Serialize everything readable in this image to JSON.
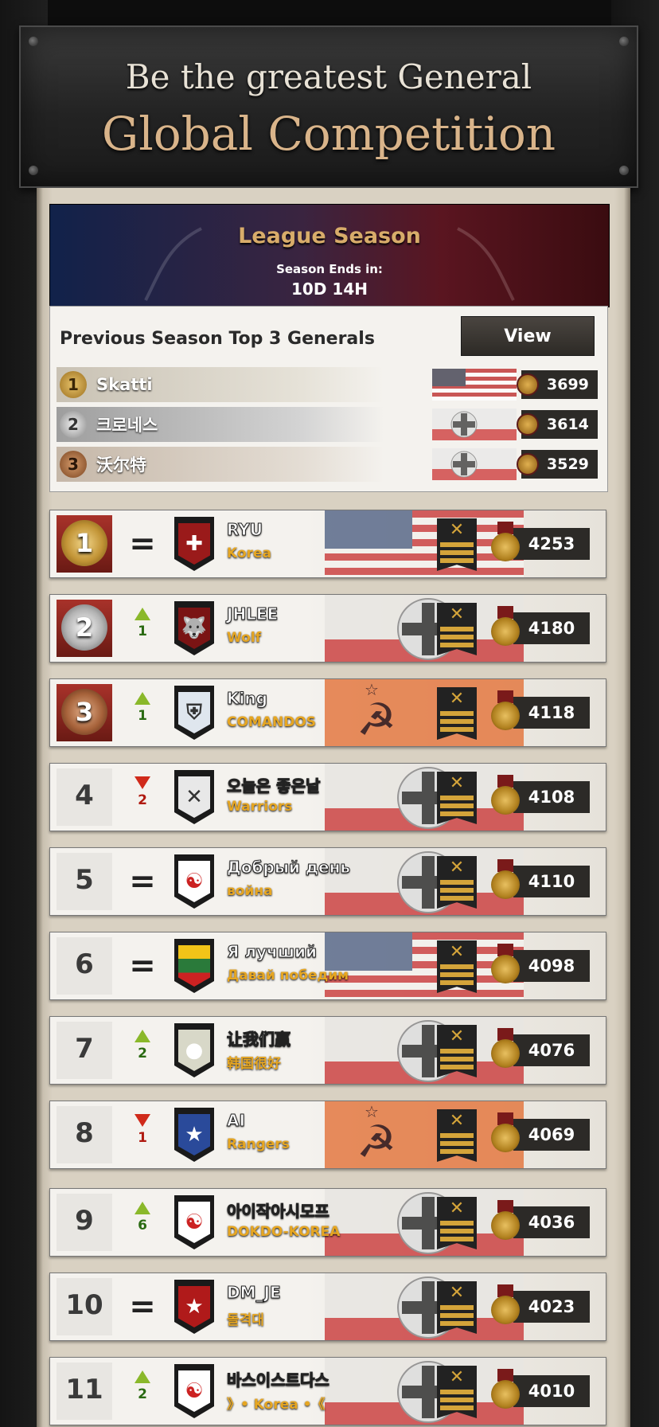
{
  "banner": {
    "subtitle": "Be the greatest General",
    "title": "Global Competition"
  },
  "season": {
    "title": "League Season",
    "ends_label": "Season Ends in:",
    "time_left": "10D 14H"
  },
  "previous": {
    "label": "Previous Season Top 3 Generals",
    "view_label": "View",
    "top": [
      {
        "rank": "1",
        "name": "Skatti",
        "flag": "usa",
        "score": "3699"
      },
      {
        "rank": "2",
        "name": "크로네스",
        "flag": "germany",
        "score": "3614"
      },
      {
        "rank": "3",
        "name": "沃尔特",
        "flag": "germany",
        "score": "3529"
      }
    ]
  },
  "rankings": [
    {
      "rank": "1",
      "change": "=",
      "name": "RYU",
      "clan": "Korea",
      "flag": "usa",
      "score": "4253",
      "emblem": "cross-emblem",
      "emblem_color": "#9a1a1a"
    },
    {
      "rank": "2",
      "change": "up",
      "change_value": "1",
      "name": "JHLEE",
      "clan": "Wolf",
      "flag": "germany",
      "score": "4180",
      "emblem": "wolf-emblem",
      "emblem_color": "#7a1414"
    },
    {
      "rank": "3",
      "change": "up",
      "change_value": "1",
      "name": "King",
      "clan": "COMANDOS",
      "flag": "soviet",
      "score": "4118",
      "emblem": "shield-emblem",
      "emblem_color": "#dfe6ee"
    },
    {
      "rank": "4",
      "change": "down",
      "change_value": "2",
      "name": "오늘은 좋은날",
      "clan": "Warriors",
      "flag": "germany",
      "score": "4108",
      "emblem": "crossed-rifles-emblem",
      "emblem_color": "#e8e8e8"
    },
    {
      "rank": "5",
      "change": "=",
      "name": "Добрый день",
      "clan": "война",
      "flag": "germany",
      "score": "4110",
      "emblem": "korea-emblem",
      "emblem_color": "#ffffff"
    },
    {
      "rank": "6",
      "change": "=",
      "name": "Я лучший",
      "clan": "Давай победим",
      "flag": "usa",
      "score": "4098",
      "emblem": "lithuania-emblem",
      "emblem_color": "#f2c418"
    },
    {
      "rank": "7",
      "change": "up",
      "change_value": "2",
      "name": "让我们赢",
      "clan": "韩国很好",
      "flag": "germany",
      "score": "4076",
      "emblem": "grenade-emblem",
      "emblem_color": "#d8d8c8"
    },
    {
      "rank": "8",
      "change": "down",
      "change_value": "1",
      "name": "AI",
      "clan": "Rangers",
      "flag": "soviet",
      "score": "4069",
      "emblem": "star-emblem",
      "emblem_color": "#2a4a9a"
    },
    {
      "rank": "9",
      "change": "up",
      "change_value": "6",
      "name": "아이작아시모프",
      "clan": "DOKDO-KOREA",
      "flag": "germany",
      "score": "4036",
      "emblem": "korea-emblem",
      "emblem_color": "#ffffff"
    },
    {
      "rank": "10",
      "change": "=",
      "name": "DM_JE",
      "clan": "돌격대",
      "flag": "germany",
      "score": "4023",
      "emblem": "star-badge-emblem",
      "emblem_color": "#b01a1a"
    },
    {
      "rank": "11",
      "change": "up",
      "change_value": "2",
      "name": "바스이스트다스",
      "clan": "》• Korea •《",
      "flag": "germany",
      "score": "4010",
      "emblem": "korea-emblem",
      "emblem_color": "#ffffff"
    }
  ],
  "colors": {
    "accent_gold": "#d8ac6a",
    "clan_text": "#e6a622",
    "up_green": "#8ab82a",
    "down_red": "#d02a1a"
  }
}
